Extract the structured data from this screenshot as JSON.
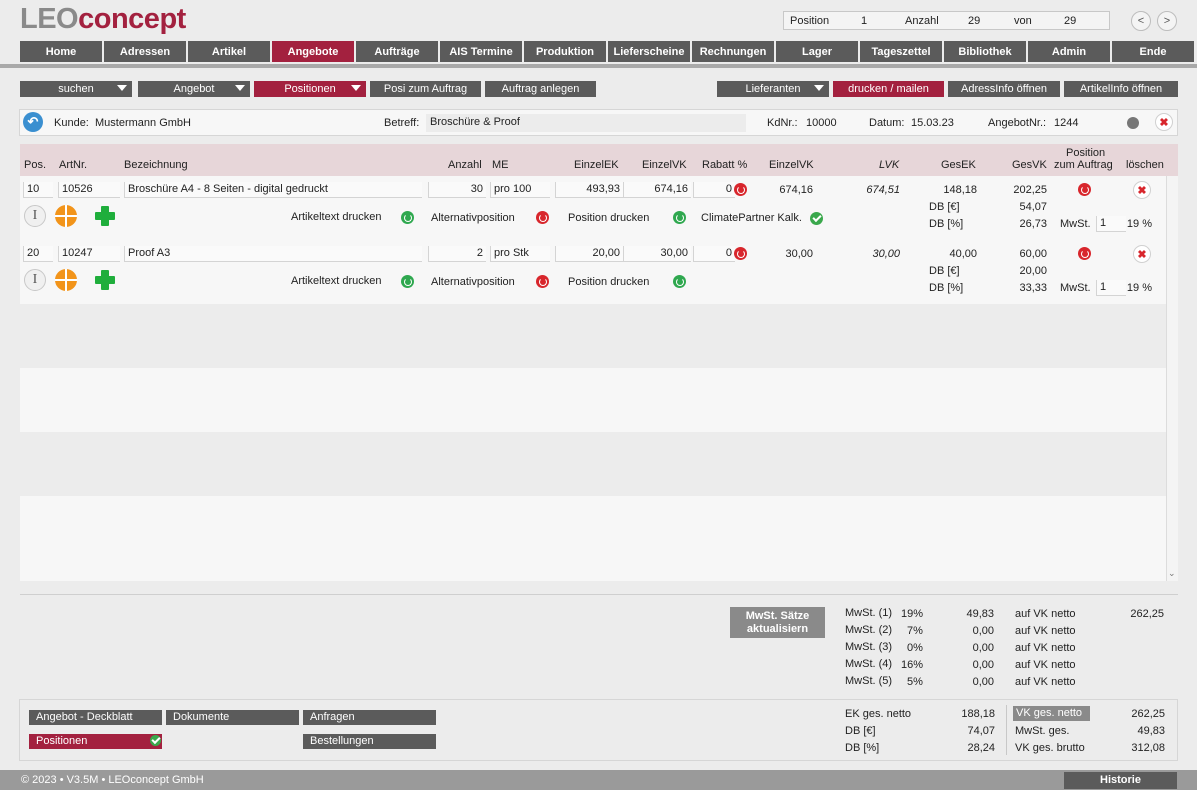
{
  "app": {
    "logo_part1": "LEO",
    "logo_part2": "concept"
  },
  "record_nav": {
    "position_label": "Position",
    "position_value": "1",
    "count_label": "Anzahl",
    "count_value": "29",
    "of_label": "von",
    "of_value": "29",
    "prev": "<",
    "next": ">"
  },
  "nav": [
    {
      "label": "Home"
    },
    {
      "label": "Adressen"
    },
    {
      "label": "Artikel"
    },
    {
      "label": "Angebote",
      "active": true
    },
    {
      "label": "Aufträge"
    },
    {
      "label": "AIS Termine"
    },
    {
      "label": "Produktion"
    },
    {
      "label": "Lieferscheine"
    },
    {
      "label": "Rechnungen"
    },
    {
      "label": "Lager"
    },
    {
      "label": "Tageszettel"
    },
    {
      "label": "Bibliothek"
    },
    {
      "label": "Admin"
    },
    {
      "label": "Ende"
    }
  ],
  "toolbar": {
    "suchen": "suchen",
    "angebot": "Angebot",
    "positionen": "Positionen",
    "posi_zum_auftrag": "Posi zum Auftrag",
    "auftrag_anlegen": "Auftrag anlegen",
    "lieferanten": "Lieferanten",
    "drucken": "drucken / mailen",
    "adressinfo": "AdressInfo öffnen",
    "artikelinfo": "ArtikelInfo öffnen"
  },
  "info": {
    "kunde_label": "Kunde:",
    "kunde": "Mustermann GmbH",
    "betreff_label": "Betreff:",
    "betreff": "Broschüre & Proof",
    "kdnr_label": "KdNr.:",
    "kdnr": "10000",
    "datum_label": "Datum:",
    "datum": "15.03.23",
    "angebotnr_label": "AngebotNr.:",
    "angebotnr": "1244"
  },
  "columns": {
    "pos": "Pos.",
    "artnr": "ArtNr.",
    "bez": "Bezeichnung",
    "anzahl": "Anzahl",
    "me": "ME",
    "einzelek": "EinzelEK",
    "einzelvk": "EinzelVK",
    "rabatt": "Rabatt %",
    "einzelvk2": "EinzelVK",
    "lvk": "LVK",
    "gesek": "GesEK",
    "gesvk": "GesVK",
    "posauftrag1": "Position",
    "posauftrag2": "zum Auftrag",
    "loeschen": "löschen"
  },
  "rows": [
    {
      "pos": "10",
      "artnr": "10526",
      "bez": "Broschüre A4 - 8 Seiten - digital gedruckt",
      "anzahl": "30",
      "me": "pro 100",
      "einzelek": "493,93",
      "einzelvk": "674,16",
      "rabatt": "0",
      "einzelvk2": "674,16",
      "lvk": "674,51",
      "gesek": "148,18",
      "gesvk": "202,25",
      "db_eur_label": "DB [€]",
      "db_eur": "54,07",
      "db_pct_label": "DB [%]",
      "db_pct": "26,73",
      "mwst_label": "MwSt.",
      "mwst_code": "1",
      "mwst_rate": "19 %",
      "artikeltext": "Artikeltext drucken",
      "alternativ": "Alternativposition",
      "posdrucken": "Position drucken",
      "climate": "ClimatePartner Kalk."
    },
    {
      "pos": "20",
      "artnr": "10247",
      "bez": "Proof A3",
      "anzahl": "2",
      "me": "pro Stk",
      "einzelek": "20,00",
      "einzelvk": "30,00",
      "rabatt": "0",
      "einzelvk2": "30,00",
      "lvk": "30,00",
      "gesek": "40,00",
      "gesvk": "60,00",
      "db_eur_label": "DB [€]",
      "db_eur": "20,00",
      "db_pct_label": "DB [%]",
      "db_pct": "33,33",
      "mwst_label": "MwSt.",
      "mwst_code": "1",
      "mwst_rate": "19 %",
      "artikeltext": "Artikeltext drucken",
      "alternativ": "Alternativposition",
      "posdrucken": "Position drucken"
    }
  ],
  "mwst_button": {
    "line1": "MwSt. Sätze",
    "line2": "aktualisiern"
  },
  "mwst": [
    {
      "label": "MwSt. (1)",
      "rate": "19%",
      "value": "49,83",
      "basis": "auf VK netto",
      "basis_value": "262,25"
    },
    {
      "label": "MwSt. (2)",
      "rate": "7%",
      "value": "0,00",
      "basis": "auf VK netto"
    },
    {
      "label": "MwSt. (3)",
      "rate": "0%",
      "value": "0,00",
      "basis": "auf VK netto"
    },
    {
      "label": "MwSt. (4)",
      "rate": "16%",
      "value": "0,00",
      "basis": "auf VK netto"
    },
    {
      "label": "MwSt. (5)",
      "rate": "5%",
      "value": "0,00",
      "basis": "auf VK netto"
    }
  ],
  "bottom": {
    "deckblatt": "Angebot - Deckblatt",
    "dokumente": "Dokumente",
    "anfragen": "Anfragen",
    "positionen": "Positionen",
    "bestellungen": "Bestellungen"
  },
  "totals": {
    "ek_label": "EK ges. netto",
    "ek": "188,18",
    "db_eur_label": "DB [€]",
    "db_eur": "74,07",
    "db_pct_label": "DB [%]",
    "db_pct": "28,24",
    "vk_netto_label": "VK ges. netto",
    "vk_netto": "262,25",
    "mwst_label": "MwSt. ges.",
    "mwst": "49,83",
    "vk_brutto_label": "VK ges. brutto",
    "vk_brutto": "312,08"
  },
  "footer": {
    "copyright": "© 2023 • V3.5M • LEOconcept GmbH",
    "historie": "Historie"
  },
  "colors": {
    "accent": "#a3213f",
    "button": "#5b5b5b",
    "header_row": "#e7d6d9"
  }
}
